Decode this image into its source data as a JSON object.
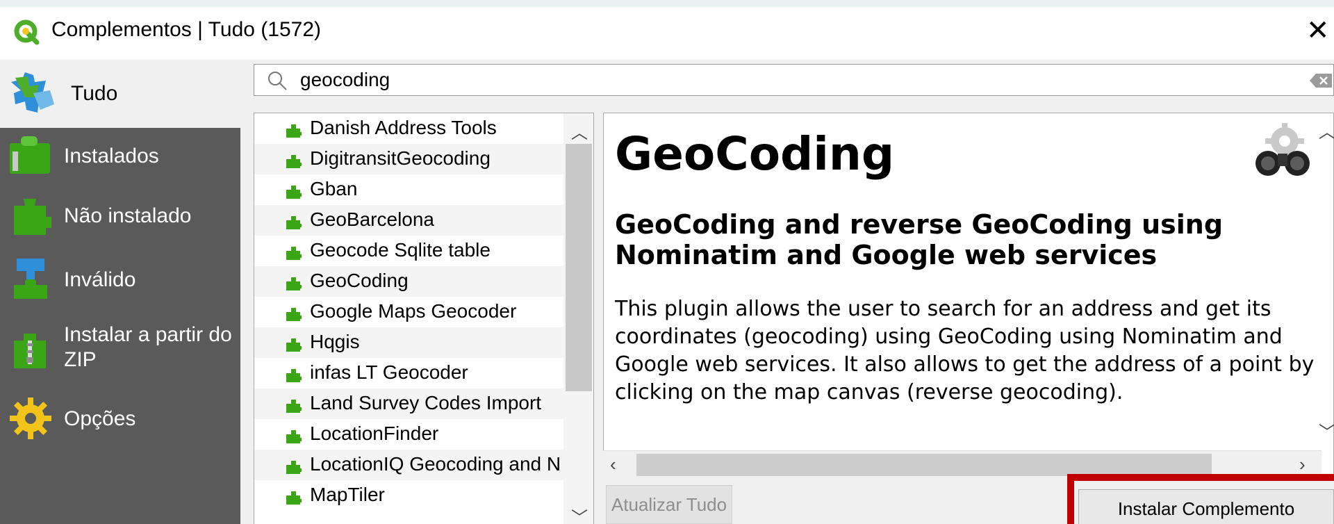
{
  "window": {
    "title": "Complementos | Tudo (1572)",
    "close_glyph": "✕"
  },
  "sidebar": {
    "items": [
      {
        "label": "Tudo",
        "icon": "puzzle-all-icon",
        "active": true
      },
      {
        "label": "Instalados",
        "icon": "puzzle-installed-icon"
      },
      {
        "label": "Não instalado",
        "icon": "puzzle-not-installed-icon"
      },
      {
        "label": "Inválido",
        "icon": "puzzle-invalid-icon"
      },
      {
        "label": "Instalar a partir do ZIP",
        "label_line1": "Instalar a partir do",
        "label_line2": "ZIP",
        "icon": "zip-install-icon"
      },
      {
        "label": "Opções",
        "icon": "gear-icon"
      }
    ]
  },
  "search": {
    "value": "geocoding",
    "placeholder": ""
  },
  "plugin_list": {
    "items": [
      "Danish Address Tools",
      "DigitransitGeocoding",
      "Gban",
      "GeoBarcelona",
      "Geocode Sqlite table",
      "GeoCoding",
      "Google Maps Geocoder",
      "Hqgis",
      "infas LT Geocoder",
      "Land Survey Codes Import",
      "LocationFinder",
      "LocationIQ Geocoding and N",
      "MapTiler"
    ]
  },
  "details": {
    "title": "GeoCoding",
    "subtitle": "GeoCoding and reverse GeoCoding using Nominatim and Google web services",
    "description": "This plugin allows the user to search for an address and get its coordinates (geocoding) using GeoCoding using Nominatim and Google web services. It also allows to get the address of a point by clicking on the map canvas (reverse geocoding).",
    "icon": "binoculars-gear-icon"
  },
  "buttons": {
    "update_all": "Atualizar Tudo",
    "install": "Instalar Complemento"
  },
  "colors": {
    "sidebar_bg": "#5a5a5a",
    "highlight": "#c00000",
    "plugin_green": "#3aa616",
    "qgis_green": "#4eae2b"
  }
}
